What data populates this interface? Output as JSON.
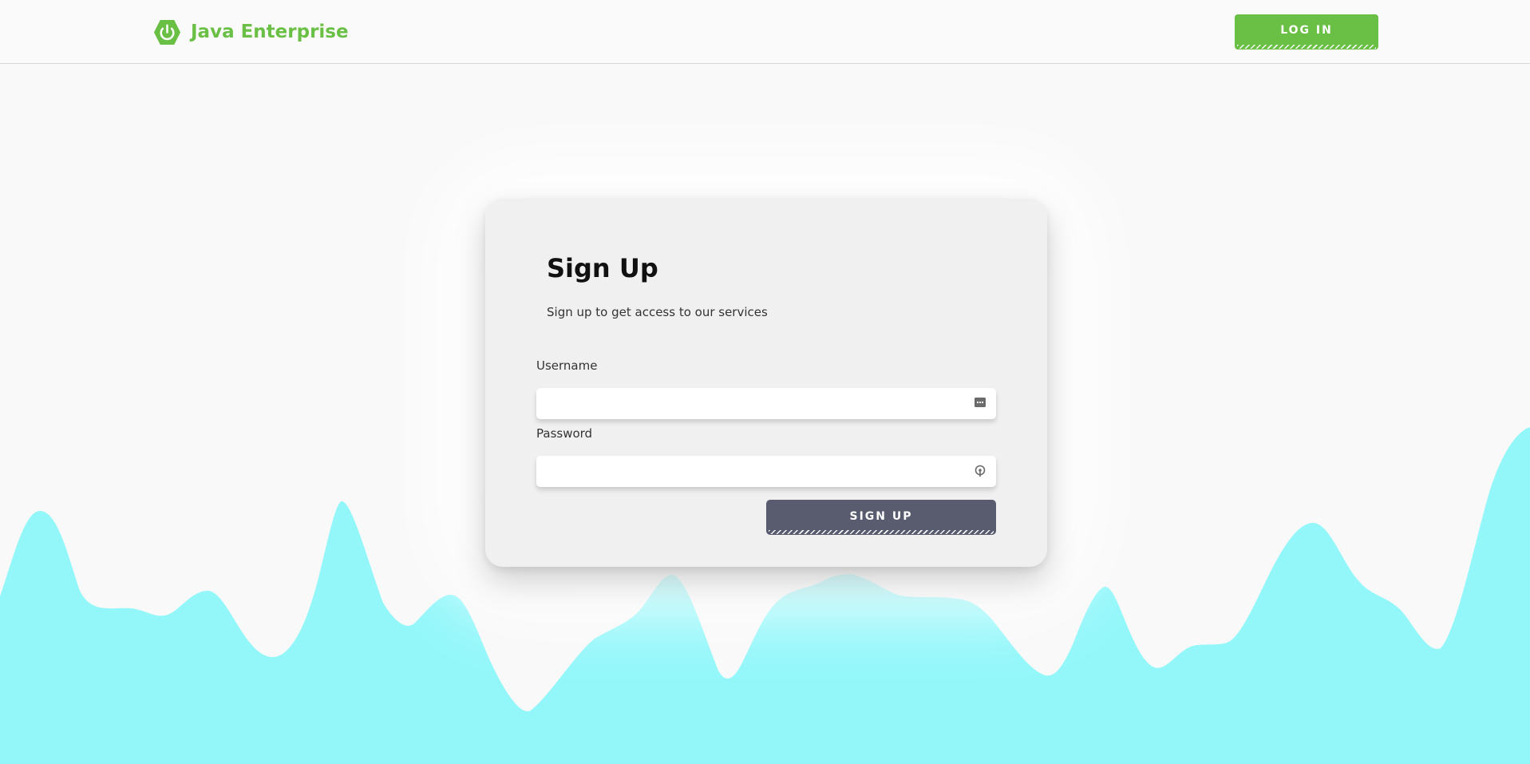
{
  "header": {
    "brand_name": "Java Enterprise",
    "login_label": "LOG IN"
  },
  "signup": {
    "title": "Sign Up",
    "subtitle": "Sign up to get access to our services",
    "username_label": "Username",
    "username_value": "",
    "password_label": "Password",
    "password_value": "",
    "submit_label": "SIGN UP"
  },
  "icons": {
    "logo": "power-hexagon-icon",
    "username_field": "more-dots-icon",
    "password_field": "key-icon"
  },
  "colors": {
    "brand_green": "#6abf45",
    "wave_cyan": "#93f7fa",
    "signup_button": "#585c6e",
    "card_background": "#f0f0f0",
    "page_background": "#f9f9f9"
  }
}
